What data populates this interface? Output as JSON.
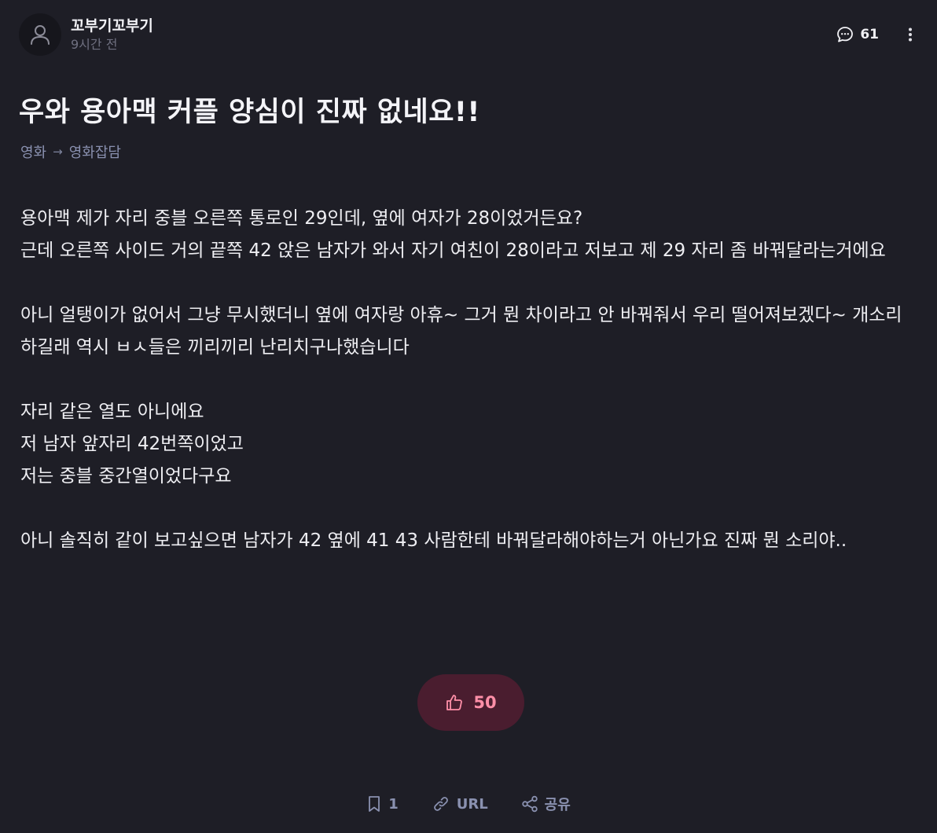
{
  "author": {
    "name": "꼬부기꼬부기",
    "time": "9시간 전"
  },
  "header": {
    "comment_count": "61"
  },
  "post": {
    "title": "우와 용아맥 커플 양심이 진짜 없네요!!",
    "breadcrumb": [
      "영화",
      "영화잡담"
    ],
    "paragraphs": [
      "용아맥 제가 자리 중블 오른쪽 통로인 29인데, 옆에 여자가 28이었거든요?\n근데 오른쪽 사이드 거의 끝쪽 42 앉은 남자가 와서 자기 여친이 28이라고 저보고 제 29 자리 좀 바꿔달라는거에요",
      "아니 얼탱이가 없어서 그냥 무시했더니 옆에 여자랑 아휴~ 그거 뭔 차이라고 안 바꿔줘서 우리 떨어져보겠다~ 개소리하길래 역시 ㅂㅅ들은 끼리끼리 난리치구나했습니다",
      "자리 같은 열도 아니에요\n저 남자 앞자리 42번쪽이었고\n저는 중블 중간열이었다구요",
      "아니 솔직히 같이 보고싶으면 남자가 42 옆에 41 43 사람한테 바꿔달라해야하는거 아닌가요 진짜 뭔 소리야.."
    ],
    "like_count": "50"
  },
  "footer": {
    "bookmark_count": "1",
    "url_label": "URL",
    "share_label": "공유"
  },
  "colors": {
    "background": "#1e1e26",
    "accent_like": "#ff8fa8",
    "like_bg": "#4a1d2f",
    "muted": "#8a91b0"
  }
}
